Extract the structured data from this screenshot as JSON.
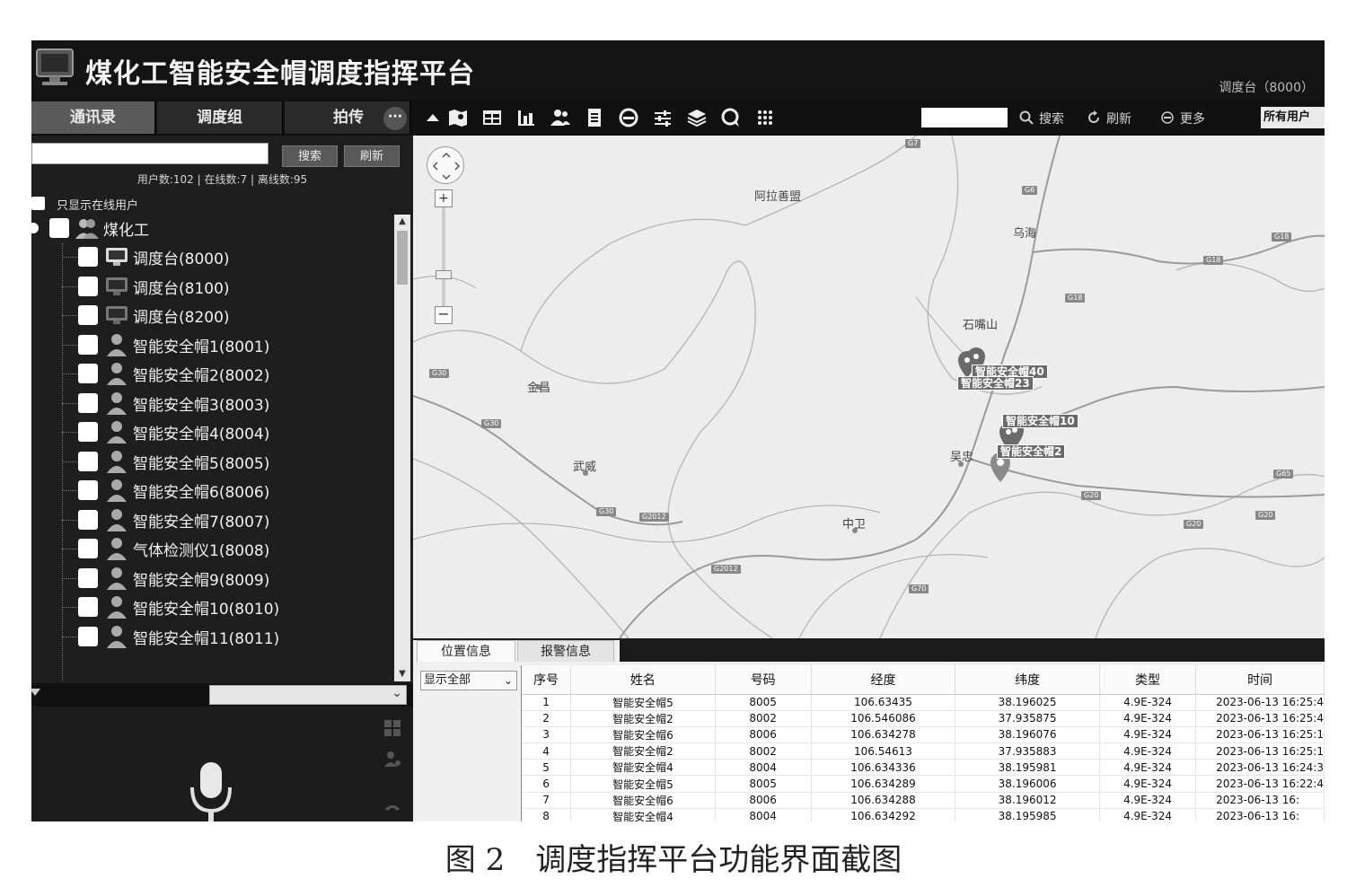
{
  "app": {
    "title": "煤化工智能安全帽调度指挥平台",
    "console_id": "调度台（8000）"
  },
  "left_panel": {
    "tabs": [
      "通讯录",
      "调度组",
      "拍传"
    ],
    "more": "···",
    "search_button": "搜索",
    "refresh_button": "刷新",
    "user_stats": "用户数:102 | 在线数:7 | 离线数:95",
    "online_only_label": "只显示在线用户",
    "tree_root": "煤化工",
    "tree_items": [
      {
        "label": "调度台(8000)",
        "icon": "console-online-icon"
      },
      {
        "label": "调度台(8100)",
        "icon": "console-offline-icon"
      },
      {
        "label": "调度台(8200)",
        "icon": "console-offline-icon"
      },
      {
        "label": "智能安全帽1(8001)",
        "icon": "user-icon"
      },
      {
        "label": "智能安全帽2(8002)",
        "icon": "user-icon"
      },
      {
        "label": "智能安全帽3(8003)",
        "icon": "user-icon"
      },
      {
        "label": "智能安全帽4(8004)",
        "icon": "user-icon"
      },
      {
        "label": "智能安全帽5(8005)",
        "icon": "user-icon"
      },
      {
        "label": "智能安全帽6(8006)",
        "icon": "user-icon"
      },
      {
        "label": "智能安全帽7(8007)",
        "icon": "user-icon"
      },
      {
        "label": "气体检测仪1(8008)",
        "icon": "user-icon"
      },
      {
        "label": "智能安全帽9(8009)",
        "icon": "user-icon"
      },
      {
        "label": "智能安全帽10(8010)",
        "icon": "user-icon"
      },
      {
        "label": "智能安全帽11(8011)",
        "icon": "user-icon"
      }
    ]
  },
  "toolbar": {
    "search_label": "搜索",
    "refresh_label": "刷新",
    "more_label": "更多",
    "scope": "所有用户"
  },
  "map": {
    "places": [
      "阿拉善盟",
      "乌海",
      "石嘴山",
      "金昌",
      "武威",
      "吴忠",
      "中卫"
    ],
    "roads": [
      "G7",
      "G6",
      "G18",
      "G18",
      "G18",
      "G30",
      "G30",
      "G30",
      "G2012",
      "G2012",
      "G70",
      "G20",
      "G20",
      "G20",
      "G65"
    ],
    "marker_labels": [
      "智能安全帽40",
      "智能安全帽23",
      "智能安全帽10",
      "智能安全帽2"
    ]
  },
  "bottom_panel": {
    "tabs": [
      "位置信息",
      "报警信息"
    ],
    "filter": "显示全部",
    "columns": [
      "序号",
      "姓名",
      "号码",
      "经度",
      "纬度",
      "类型",
      "时间"
    ],
    "rows": [
      [
        "1",
        "智能安全帽5",
        "8005",
        "106.63435",
        "38.196025",
        "4.9E-324",
        "2023-06-13 16:25:4"
      ],
      [
        "2",
        "智能安全帽2",
        "8002",
        "106.546086",
        "37.935875",
        "4.9E-324",
        "2023-06-13 16:25:4"
      ],
      [
        "3",
        "智能安全帽6",
        "8006",
        "106.634278",
        "38.196076",
        "4.9E-324",
        "2023-06-13 16:25:1"
      ],
      [
        "4",
        "智能安全帽2",
        "8002",
        "106.54613",
        "37.935883",
        "4.9E-324",
        "2023-06-13 16:25:1"
      ],
      [
        "5",
        "智能安全帽4",
        "8004",
        "106.634336",
        "38.195981",
        "4.9E-324",
        "2023-06-13 16:24:3"
      ],
      [
        "6",
        "智能安全帽5",
        "8005",
        "106.634289",
        "38.196006",
        "4.9E-324",
        "2023-06-13 16:22:4"
      ],
      [
        "7",
        "智能安全帽6",
        "8006",
        "106.634288",
        "38.196012",
        "4.9E-324",
        "2023-06-13 16:"
      ],
      [
        "8",
        "智能安全帽4",
        "8004",
        "106.634292",
        "38.195985",
        "4.9E-324",
        "2023-06-13 16:"
      ]
    ]
  },
  "caption": "图 2　调度指挥平台功能界面截图"
}
